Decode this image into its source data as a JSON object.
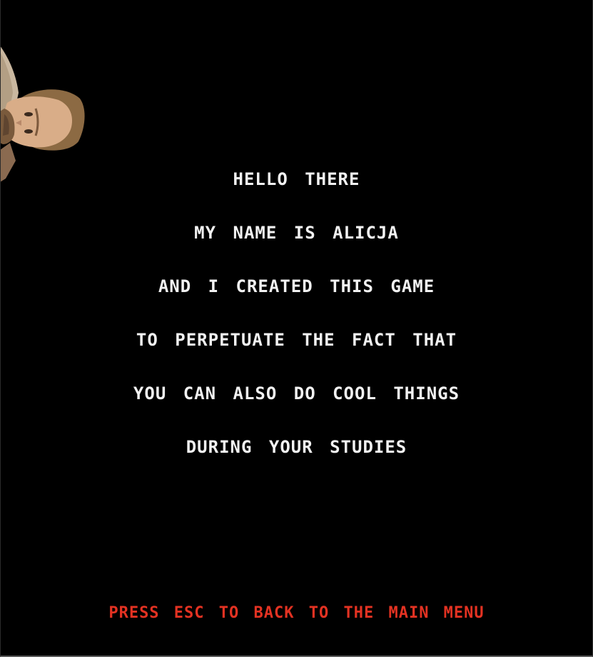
{
  "credits_lines": [
    "HELLO THERE",
    "MY NAME IS ALICJA",
    "AND I CREATED THIS GAME",
    "TO PERPETUATE THE FACT THAT",
    "YOU CAN ALSO DO COOL THINGS",
    "DURING YOUR STUDIES"
  ],
  "footer_hint": "PRESS ESC TO BACK TO THE MAIN MENU",
  "colors": {
    "background": "#000000",
    "text": "#f2f2f2",
    "hint": "#e33222"
  },
  "character": "peeking-man-sprite"
}
